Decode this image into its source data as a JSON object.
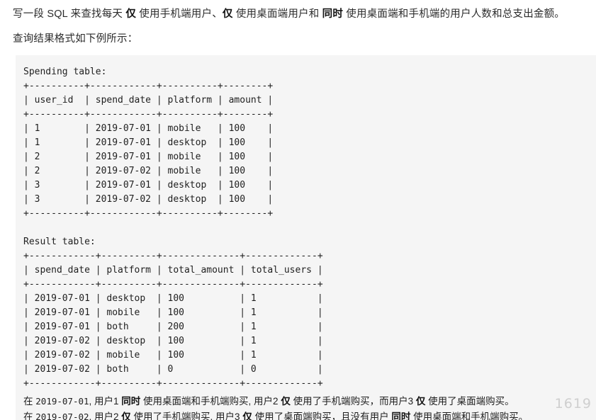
{
  "intro": {
    "line1_parts": [
      {
        "text": "写一段 SQL 来查找每天 ",
        "bold": false
      },
      {
        "text": "仅",
        "bold": true
      },
      {
        "text": " 使用手机端用户、",
        "bold": false
      },
      {
        "text": "仅",
        "bold": true
      },
      {
        "text": " 使用桌面端用户和 ",
        "bold": false
      },
      {
        "text": "同时",
        "bold": true
      },
      {
        "text": " 使用桌面端和手机端的用户人数和总支出金额。",
        "bold": false
      }
    ],
    "line1_plain": "写一段 SQL 来查找每天 仅 使用手机端用户、仅 使用桌面端用户和 同时 使用桌面端和手机端的用户人数和总支出金额。",
    "line2": "查询结果格式如下例所示："
  },
  "code": {
    "spending_title": "Spending table:",
    "spending_sep": "+----------+------------+----------+--------+",
    "spending_header": "| user_id  | spend_date | platform | amount |",
    "spending_rows": [
      "| 1        | 2019-07-01 | mobile   | 100    |",
      "| 1        | 2019-07-01 | desktop  | 100    |",
      "| 2        | 2019-07-01 | mobile   | 100    |",
      "| 2        | 2019-07-02 | mobile   | 100    |",
      "| 3        | 2019-07-01 | desktop  | 100    |",
      "| 3        | 2019-07-02 | desktop  | 100    |"
    ],
    "result_title": "Result table:",
    "result_sep": "+------------+----------+--------------+-------------+",
    "result_header": "| spend_date | platform | total_amount | total_users |",
    "result_rows": [
      "| 2019-07-01 | desktop  | 100          | 1           |",
      "| 2019-07-01 | mobile   | 100          | 1           |",
      "| 2019-07-01 | both     | 200          | 1           |",
      "| 2019-07-02 | desktop  | 100          | 1           |",
      "| 2019-07-02 | mobile   | 100          | 1           |",
      "| 2019-07-02 | both     | 0            | 0           |"
    ]
  },
  "tables": {
    "spending": {
      "name": "Spending table",
      "columns": [
        "user_id",
        "spend_date",
        "platform",
        "amount"
      ],
      "rows": [
        [
          "1",
          "2019-07-01",
          "mobile",
          "100"
        ],
        [
          "1",
          "2019-07-01",
          "desktop",
          "100"
        ],
        [
          "2",
          "2019-07-01",
          "mobile",
          "100"
        ],
        [
          "2",
          "2019-07-02",
          "mobile",
          "100"
        ],
        [
          "3",
          "2019-07-01",
          "desktop",
          "100"
        ],
        [
          "3",
          "2019-07-02",
          "desktop",
          "100"
        ]
      ]
    },
    "result": {
      "name": "Result table",
      "columns": [
        "spend_date",
        "platform",
        "total_amount",
        "total_users"
      ],
      "rows": [
        [
          "2019-07-01",
          "desktop",
          "100",
          "1"
        ],
        [
          "2019-07-01",
          "mobile",
          "100",
          "1"
        ],
        [
          "2019-07-01",
          "both",
          "200",
          "1"
        ],
        [
          "2019-07-02",
          "desktop",
          "100",
          "1"
        ],
        [
          "2019-07-02",
          "mobile",
          "100",
          "1"
        ],
        [
          "2019-07-02",
          "both",
          "0",
          "0"
        ]
      ]
    }
  },
  "notes": {
    "line1_parts": [
      {
        "text": "在 ",
        "bold": false,
        "mono": false
      },
      {
        "text": "2019-07-01",
        "bold": false,
        "mono": true
      },
      {
        "text": ", 用户1 ",
        "bold": false,
        "mono": false
      },
      {
        "text": "同时",
        "bold": true,
        "mono": false
      },
      {
        "text": " 使用桌面端和手机端购买, 用户2 ",
        "bold": false,
        "mono": false
      },
      {
        "text": "仅",
        "bold": true,
        "mono": false
      },
      {
        "text": " 使用了手机端购买，而用户3 ",
        "bold": false,
        "mono": false
      },
      {
        "text": "仅",
        "bold": true,
        "mono": false
      },
      {
        "text": " 使用了桌面端购买。",
        "bold": false,
        "mono": false
      }
    ],
    "line1_plain": "在 2019-07-01, 用户1 同时 使用桌面端和手机端购买, 用户2 仅 使用了手机端购买，而用户3 仅 使用了桌面端购买。",
    "line2_parts": [
      {
        "text": "在 ",
        "bold": false,
        "mono": false
      },
      {
        "text": "2019-07-02",
        "bold": false,
        "mono": true
      },
      {
        "text": ", 用户2 ",
        "bold": false,
        "mono": false
      },
      {
        "text": "仅",
        "bold": true,
        "mono": false
      },
      {
        "text": " 使用了手机端购买, 用户3 ",
        "bold": false,
        "mono": false
      },
      {
        "text": "仅",
        "bold": true,
        "mono": false
      },
      {
        "text": " 使用了桌面端购买，且没有用户 ",
        "bold": false,
        "mono": false
      },
      {
        "text": "同时",
        "bold": true,
        "mono": false
      },
      {
        "text": " 使用桌面端和手机端购买。",
        "bold": false,
        "mono": false
      }
    ],
    "line2_plain": "在 2019-07-02, 用户2 仅 使用了手机端购买, 用户3 仅 使用了桌面端购买，且没有用户 同时 使用桌面端和手机端购买。"
  },
  "watermark": {
    "text": "1619"
  },
  "colors": {
    "page_background": "#ffffff",
    "code_background": "#f5f5f5",
    "text": "#1f1f1f",
    "bold_text": "#111111"
  }
}
